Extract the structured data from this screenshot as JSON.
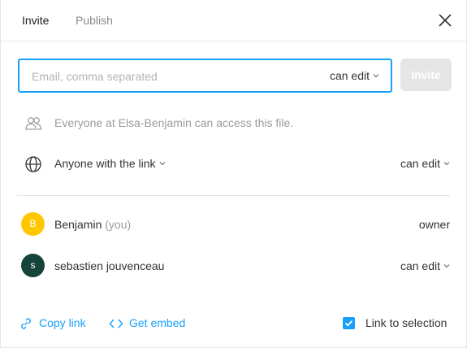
{
  "header": {
    "tabs": [
      {
        "label": "Invite",
        "active": true
      },
      {
        "label": "Publish",
        "active": false
      }
    ]
  },
  "invite": {
    "email_placeholder": "Email, comma separated",
    "email_value": "",
    "permission": "can edit",
    "button_label": "Invite"
  },
  "access": {
    "team_text": "Everyone at Elsa-Benjamin can access this file.",
    "link_label": "Anyone with the link",
    "link_permission": "can edit"
  },
  "members": [
    {
      "initial": "B",
      "name": "Benjamin",
      "suffix": "(you)",
      "role": "owner",
      "color": "#ffc700"
    },
    {
      "initial": "s",
      "name": "sebastien jouvenceau",
      "suffix": "",
      "role": "can edit",
      "color": "#16433a"
    }
  ],
  "footer": {
    "copy_link": "Copy link",
    "get_embed": "Get embed",
    "link_to_selection": "Link to selection",
    "link_to_selection_checked": true
  },
  "colors": {
    "accent": "#18a0fb",
    "disabled_button": "#e5e5e5",
    "avatar_b": "#ffc700",
    "avatar_s": "#16433a"
  },
  "icons": [
    "close-icon",
    "team-icon",
    "globe-icon",
    "chevron-down-icon",
    "link-icon",
    "code-icon",
    "checkmark-icon"
  ]
}
